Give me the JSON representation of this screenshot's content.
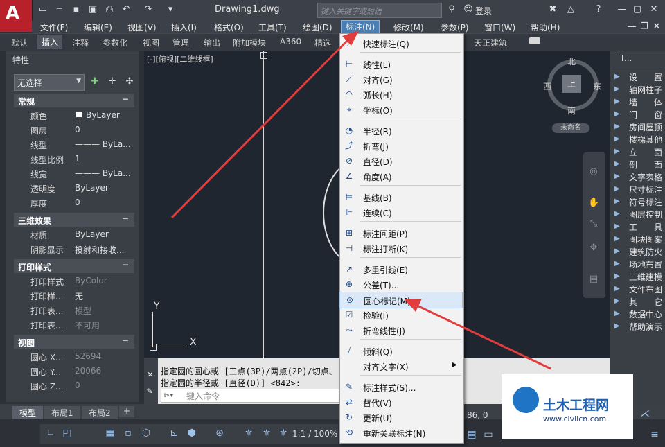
{
  "window": {
    "title": "Drawing1.dwg",
    "search_placeholder": "键入关键字或短语",
    "login": "登录"
  },
  "menubar": [
    "文件(F)",
    "编辑(E)",
    "视图(V)",
    "插入(I)",
    "格式(O)",
    "工具(T)",
    "绘图(D)",
    "标注(N)",
    "修改(M)",
    "参数(P)",
    "窗口(W)",
    "帮助(H)"
  ],
  "ribbon_tabs": [
    "默认",
    "插入",
    "注释",
    "参数化",
    "视图",
    "管理",
    "输出",
    "附加模块",
    "A360",
    "精选",
    "天正建筑"
  ],
  "properties": {
    "title": "特性",
    "selection": "无选择",
    "sections": {
      "general": {
        "title": "常规",
        "rows": [
          [
            "颜色",
            "ByLayer"
          ],
          [
            "图层",
            "0"
          ],
          [
            "线型",
            "——— ByLa..."
          ],
          [
            "线型比例",
            "1"
          ],
          [
            "线宽",
            "——— ByLa..."
          ],
          [
            "透明度",
            "ByLayer"
          ],
          [
            "厚度",
            "0"
          ]
        ]
      },
      "three_d": {
        "title": "三维效果",
        "rows": [
          [
            "材质",
            "ByLayer"
          ],
          [
            "阴影显示",
            "投射和接收..."
          ]
        ]
      },
      "plot": {
        "title": "打印样式",
        "rows": [
          [
            "打印样式",
            "ByColor"
          ],
          [
            "打印样...",
            "无"
          ],
          [
            "打印表...",
            "模型"
          ],
          [
            "打印表...",
            "不可用"
          ]
        ]
      },
      "view": {
        "title": "视图",
        "rows": [
          [
            "圆心 X...",
            "52694"
          ],
          [
            "圆心 Y...",
            "20066"
          ],
          [
            "圆心 Z...",
            "0"
          ]
        ]
      }
    }
  },
  "canvas": {
    "viewport_label": "[-][俯视][二维线框]",
    "compass": {
      "n": "北",
      "s": "南",
      "e": "东",
      "w": "西",
      "center": "上"
    },
    "unnamed": "未命名",
    "ucs_y": "Y",
    "ucs_x": "X"
  },
  "cmdline": {
    "line1": "指定圆的圆心或 [三点(3P)/两点(2P)/切点、",
    "line2": "指定圆的半径或 [直径(D)] <842>:",
    "input_placeholder": "键入命令"
  },
  "layout_tabs": [
    "模型",
    "布局1",
    "布局2"
  ],
  "status": {
    "scale": "1:1 / 100%",
    "coord": "86, 0"
  },
  "right_panel": {
    "title": "T...",
    "items": [
      "设　　置",
      "轴网柱子",
      "墙　　体",
      "门　　窗",
      "房间屋顶",
      "楼梯其他",
      "立　　面",
      "剖　　面",
      "文字表格",
      "尺寸标注",
      "符号标注",
      "图层控制",
      "工　　具",
      "图块图案",
      "建筑防火",
      "场地布置",
      "三维建模",
      "文件布图",
      "其　　它",
      "数据中心",
      "帮助演示"
    ]
  },
  "dropdown": {
    "items": [
      {
        "icon": "⚡",
        "label": "快速标注(Q)"
      },
      {
        "icon": "⊢",
        "label": "线性(L)"
      },
      {
        "icon": "⟋",
        "label": "对齐(G)"
      },
      {
        "icon": "◠",
        "label": "弧长(H)"
      },
      {
        "icon": "⌖",
        "label": "坐标(O)"
      },
      {
        "icon": "◔",
        "label": "半径(R)"
      },
      {
        "icon": "⤴",
        "label": "折弯(J)"
      },
      {
        "icon": "⊘",
        "label": "直径(D)"
      },
      {
        "icon": "∠",
        "label": "角度(A)"
      },
      {
        "icon": "⊨",
        "label": "基线(B)"
      },
      {
        "icon": "⊩",
        "label": "连续(C)"
      },
      {
        "icon": "⊞",
        "label": "标注间距(P)"
      },
      {
        "icon": "⊣",
        "label": "标注打断(K)"
      },
      {
        "icon": "↗",
        "label": "多重引线(E)"
      },
      {
        "icon": "⊕",
        "label": "公差(T)..."
      },
      {
        "icon": "⊙",
        "label": "圆心标记(M)"
      },
      {
        "icon": "☑",
        "label": "检验(I)"
      },
      {
        "icon": "⤳",
        "label": "折弯线性(J)"
      },
      {
        "icon": "⧸",
        "label": "倾斜(Q)"
      },
      {
        "icon": "",
        "label": "对齐文字(X)"
      },
      {
        "icon": "✎",
        "label": "标注样式(S)..."
      },
      {
        "icon": "⇄",
        "label": "替代(V)"
      },
      {
        "icon": "↻",
        "label": "更新(U)"
      },
      {
        "icon": "⟲",
        "label": "重新关联标注(N)"
      }
    ]
  },
  "watermark": {
    "title": "土木工程网",
    "url": "www.civilcn.com"
  }
}
